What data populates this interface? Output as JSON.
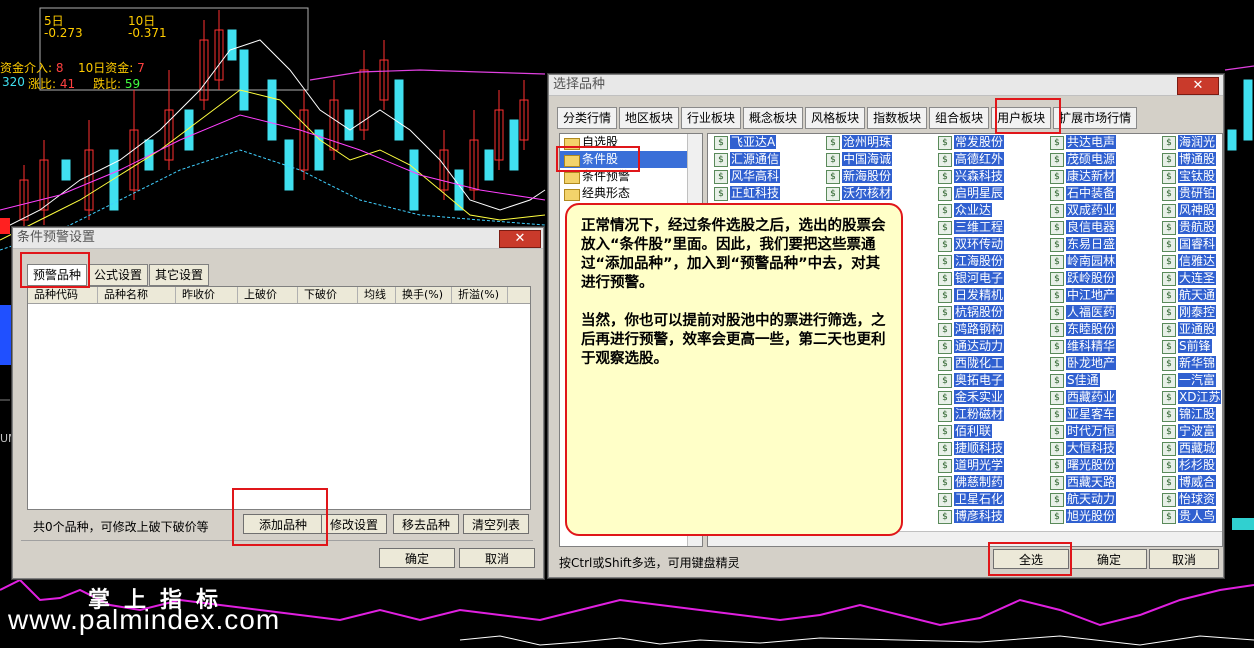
{
  "chart_indicators": {
    "label_5": "5日",
    "value_5": "-0.273",
    "label_10": "10日",
    "value_10": "-0.371",
    "fund_in_label": "资金介入:",
    "fund_in_value": "8",
    "fund10_label": "10日资金:",
    "fund10_value": "7",
    "left_num": "320",
    "up_label": "涨比:",
    "up_value": "41",
    "down_label": "跌比:",
    "down_value": "59",
    "side_label": "UM"
  },
  "watermark": {
    "cn": "掌上指标",
    "url": "www.palmindex.com"
  },
  "alert_dialog": {
    "title": "条件预警设置",
    "close": "✕",
    "tabs": [
      "预警品种",
      "公式设置",
      "其它设置"
    ],
    "columns": [
      "品种代码",
      "品种名称",
      "昨收价",
      "上破价",
      "下破价",
      "均线",
      "换手(%)",
      "折溢(%)"
    ],
    "status": "共0个品种，可修改上破下破价等",
    "buttons": {
      "add": "添加品种",
      "edit": "修改设置",
      "remove": "移去品种",
      "clear": "清空列表",
      "ok": "确定",
      "cancel": "取消"
    }
  },
  "select_dialog": {
    "title": "选择品种",
    "close": "✕",
    "toolbar": [
      "分类行情",
      "地区板块",
      "行业板块",
      "概念板块",
      "风格板块",
      "指数板块",
      "组合板块",
      "用户板块",
      "扩展市场行情"
    ],
    "tree": [
      "自选股",
      "条件股",
      "条件预警",
      "经典形态"
    ],
    "stock_icon": "$",
    "columns": [
      [
        "飞亚达A",
        "汇源通信",
        "风华高科",
        "正虹科技"
      ],
      [
        "沧州明珠",
        "中国海诚",
        "新海股份",
        "沃尔核材"
      ],
      [
        "常发股份",
        "高德红外",
        "兴森科技",
        "启明星辰",
        "众业达",
        "三维工程",
        "双环传动",
        "江海股份",
        "银河电子",
        "日发精机",
        "杭锅股份",
        "鸿路钢构",
        "通达动力",
        "西陇化工",
        "奥拓电子",
        "金禾实业",
        "江粉磁材",
        "佰利联",
        "捷顺科技",
        "道明光学",
        "佛慈制药",
        "卫星石化",
        "博彦科技"
      ],
      [
        "共达电声",
        "茂硕电源",
        "康达新材",
        "石中装备",
        "双成药业",
        "良信电器",
        "东易日盛",
        "岭南园林",
        "跃岭股份",
        "中江地产",
        "人福医药",
        "东睦股份",
        "维科精华",
        "卧龙地产",
        "S佳通",
        "西藏药业",
        "亚星客车",
        "时代万恒",
        "大恒科技",
        "曙光股份",
        "西藏天路",
        "航天动力",
        "旭光股份"
      ],
      [
        "海润光",
        "博通股",
        "宝钛股",
        "贵研铂",
        "风神股",
        "贵航股",
        "国睿科",
        "信雅达",
        "大连圣",
        "航天通",
        "刚泰控",
        "亚通股",
        "S前锋",
        "新华锦",
        "一汽富",
        "XD江苏",
        "锦江股",
        "宁波富",
        "西藏城",
        "杉杉股",
        "博威合",
        "怡球资",
        "贵人鸟"
      ]
    ],
    "callout": {
      "p1": "正常情况下，经过条件选股之后，选出的股票会放入“条件股”里面。因此，我们要把这些票通过“添加品种”，加入到“预警品种”中去，对其进行预警。",
      "p2": "当然，你也可以提前对股池中的票进行筛选，之后再进行预警，效率会更高一些，第二天也更利于观察选股。"
    },
    "status": "按Ctrl或Shift多选，可用键盘精灵",
    "buttons": {
      "select_all": "全选",
      "ok": "确定",
      "cancel": "取消"
    }
  },
  "colors": {
    "accent_red": "#e0161a",
    "selection_blue": "#3060d0",
    "callout_bg": "#ffffc8"
  }
}
